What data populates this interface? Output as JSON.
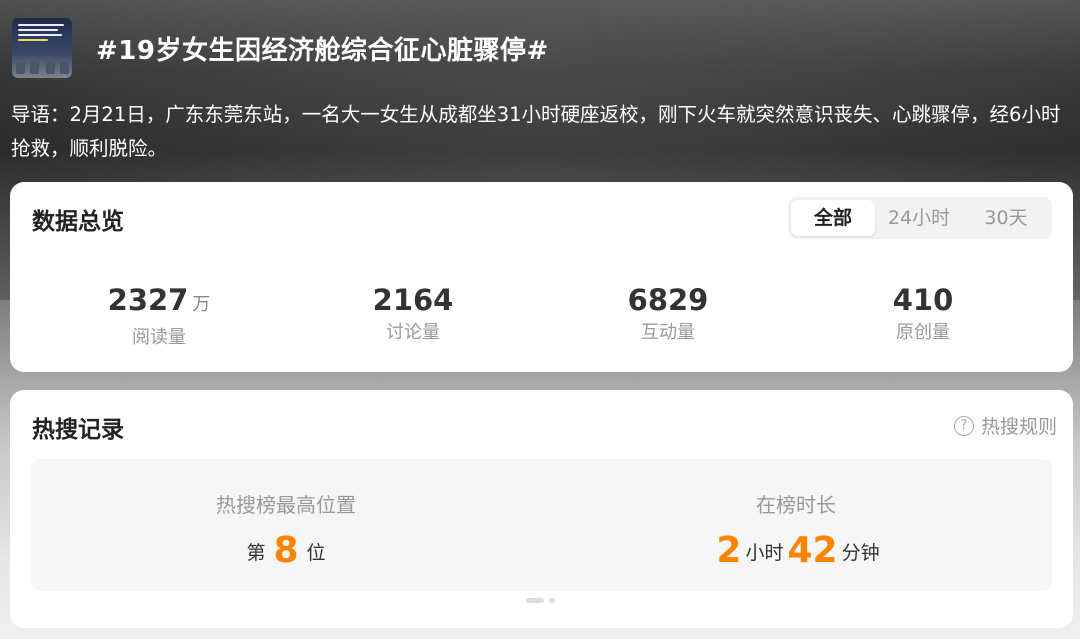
{
  "topic": {
    "title": "#19岁女生因经济舱综合征心脏骤停#",
    "intro": "导语：2月21日，广东东莞东站，一名大一女生从成都坐31小时硬座返校，刚下火车就突然意识丧失、心跳骤停，经6小时抢救，顺利脱险。"
  },
  "overview": {
    "title": "数据总览",
    "tabs": [
      "全部",
      "24小时",
      "30天"
    ],
    "active_tab": "全部",
    "stats": [
      {
        "value": "2327",
        "unit": "万",
        "label": "阅读量"
      },
      {
        "value": "2164",
        "unit": "",
        "label": "讨论量"
      },
      {
        "value": "6829",
        "unit": "",
        "label": "互动量"
      },
      {
        "value": "410",
        "unit": "",
        "label": "原创量"
      }
    ]
  },
  "hot_record": {
    "title": "热搜记录",
    "rules_label": "热搜规则",
    "rules_icon": "question-circle-icon",
    "peak": {
      "label": "热搜榜最高位置",
      "prefix": "第",
      "value": "8",
      "suffix": "位"
    },
    "duration": {
      "label": "在榜时长",
      "hours": "2",
      "hours_unit": "小时",
      "minutes": "42",
      "minutes_unit": "分钟"
    }
  },
  "colors": {
    "accent": "#ff8200",
    "card": "#ffffff",
    "muted_text": "#999999"
  }
}
